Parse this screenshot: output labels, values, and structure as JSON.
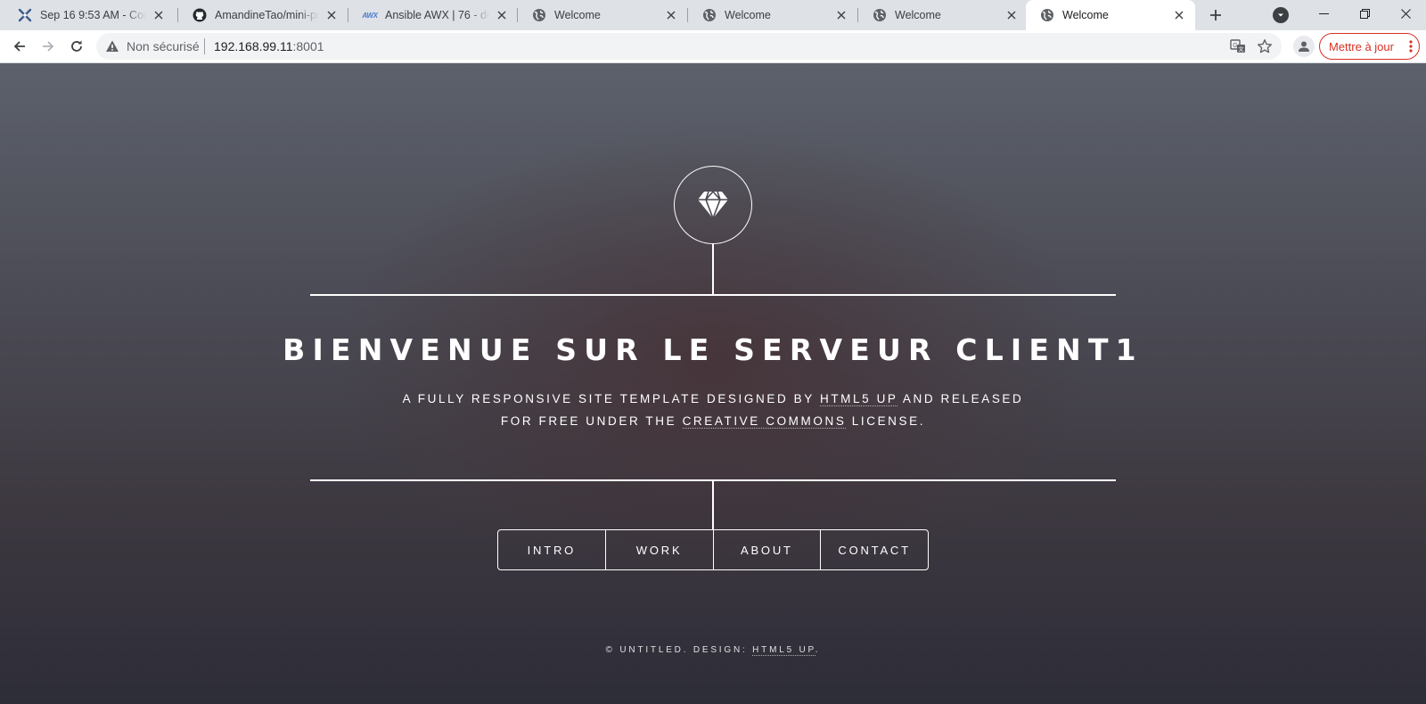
{
  "browser": {
    "tabs": [
      {
        "title": "Sep 16 9:53 AM - Codes",
        "icon": "codeshare-icon"
      },
      {
        "title": "AmandineTao/mini-proje",
        "icon": "github-icon"
      },
      {
        "title": "Ansible AWX | 76 - deplo",
        "icon": "awx-icon",
        "icon_text": "AWX"
      },
      {
        "title": "Welcome",
        "icon": "globe-icon"
      },
      {
        "title": "Welcome",
        "icon": "globe-icon"
      },
      {
        "title": "Welcome",
        "icon": "globe-icon"
      },
      {
        "title": "Welcome",
        "icon": "globe-icon",
        "active": true
      }
    ],
    "address_bar": {
      "security_label": "Non sécurisé",
      "host": "192.168.99.11",
      "port": ":8001"
    },
    "update_button": "Mettre à jour"
  },
  "page": {
    "logo_icon": "diamond-icon",
    "heading": "BIENVENUE SUR LE SERVEUR CLIENT1",
    "subtitle": {
      "line1_before": "A FULLY RESPONSIVE SITE TEMPLATE DESIGNED BY ",
      "line1_link": "HTML5 UP",
      "line1_after": " AND RELEASED",
      "line2_before": "FOR FREE UNDER THE ",
      "line2_link": "CREATIVE COMMONS",
      "line2_after": " LICENSE."
    },
    "nav": [
      "INTRO",
      "WORK",
      "ABOUT",
      "CONTACT"
    ],
    "footer": {
      "text": "© UNTITLED. DESIGN: ",
      "link": "HTML5 UP",
      "end": "."
    }
  },
  "colors": {
    "update_red": "#d93025",
    "tabstrip": "#dee1e6",
    "page_bg_top": "#5c616b",
    "page_bg_bottom": "#2d2d38"
  }
}
